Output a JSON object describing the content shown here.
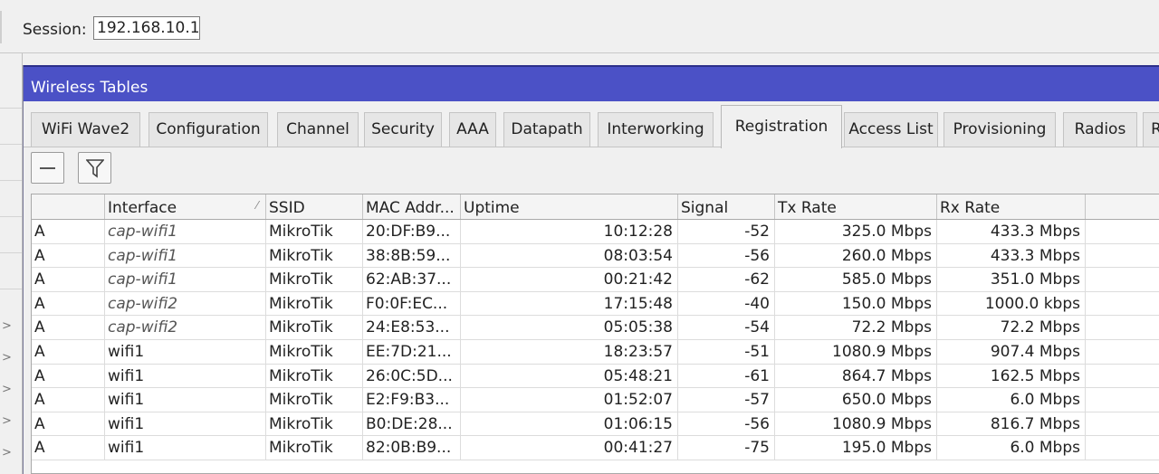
{
  "session": {
    "label": "Session:",
    "value": "192.168.10.1"
  },
  "window": {
    "title": "Wireless Tables"
  },
  "tabs": [
    {
      "label": "WiFi Wave2",
      "active": false
    },
    {
      "label": "Configuration",
      "active": false
    },
    {
      "label": "Channel",
      "active": false
    },
    {
      "label": "Security",
      "active": false
    },
    {
      "label": "AAA",
      "active": false
    },
    {
      "label": "Datapath",
      "active": false
    },
    {
      "label": "Interworking",
      "active": false
    },
    {
      "label": "Registration",
      "active": true
    },
    {
      "label": "Access List",
      "active": false
    },
    {
      "label": "Provisioning",
      "active": false
    },
    {
      "label": "Radios",
      "active": false
    },
    {
      "label": "R",
      "active": false
    }
  ],
  "toolbar": {
    "remove_icon": "minus-icon",
    "filter_icon": "filter-icon"
  },
  "table": {
    "columns": [
      "",
      "Interface",
      "SSID",
      "MAC Addr...",
      "Uptime",
      "Signal",
      "Tx Rate",
      "Rx Rate",
      ""
    ],
    "sort_column": "Interface",
    "rows": [
      {
        "flag": "A",
        "interface": "cap-wifi1",
        "italic": true,
        "ssid": "MikroTik",
        "mac": "20:DF:B9...",
        "uptime": "10:12:28",
        "signal": "-52",
        "tx": "325.0 Mbps",
        "rx": "433.3 Mbps"
      },
      {
        "flag": "A",
        "interface": "cap-wifi1",
        "italic": true,
        "ssid": "MikroTik",
        "mac": "38:8B:59...",
        "uptime": "08:03:54",
        "signal": "-56",
        "tx": "260.0 Mbps",
        "rx": "433.3 Mbps"
      },
      {
        "flag": "A",
        "interface": "cap-wifi1",
        "italic": true,
        "ssid": "MikroTik",
        "mac": "62:AB:37...",
        "uptime": "00:21:42",
        "signal": "-62",
        "tx": "585.0 Mbps",
        "rx": "351.0 Mbps"
      },
      {
        "flag": "A",
        "interface": "cap-wifi2",
        "italic": true,
        "ssid": "MikroTik",
        "mac": "F0:0F:EC...",
        "uptime": "17:15:48",
        "signal": "-40",
        "tx": "150.0 Mbps",
        "rx": "1000.0 kbps"
      },
      {
        "flag": "A",
        "interface": "cap-wifi2",
        "italic": true,
        "ssid": "MikroTik",
        "mac": "24:E8:53...",
        "uptime": "05:05:38",
        "signal": "-54",
        "tx": "72.2 Mbps",
        "rx": "72.2 Mbps"
      },
      {
        "flag": "A",
        "interface": "wifi1",
        "italic": false,
        "ssid": "MikroTik",
        "mac": "EE:7D:21...",
        "uptime": "18:23:57",
        "signal": "-51",
        "tx": "1080.9 Mbps",
        "rx": "907.4 Mbps"
      },
      {
        "flag": "A",
        "interface": "wifi1",
        "italic": false,
        "ssid": "MikroTik",
        "mac": "26:0C:5D...",
        "uptime": "05:48:21",
        "signal": "-61",
        "tx": "864.7 Mbps",
        "rx": "162.5 Mbps"
      },
      {
        "flag": "A",
        "interface": "wifi1",
        "italic": false,
        "ssid": "MikroTik",
        "mac": "E2:F9:B3...",
        "uptime": "01:52:07",
        "signal": "-57",
        "tx": "650.0 Mbps",
        "rx": "6.0 Mbps"
      },
      {
        "flag": "A",
        "interface": "wifi1",
        "italic": false,
        "ssid": "MikroTik",
        "mac": "B0:DE:28...",
        "uptime": "01:06:15",
        "signal": "-56",
        "tx": "1080.9 Mbps",
        "rx": "816.7 Mbps"
      },
      {
        "flag": "A",
        "interface": "wifi1",
        "italic": false,
        "ssid": "MikroTik",
        "mac": "82:0B:B9...",
        "uptime": "00:41:27",
        "signal": "-75",
        "tx": "195.0 Mbps",
        "rx": "6.0 Mbps"
      }
    ]
  },
  "colors": {
    "titlebar": "#4b51c6",
    "background": "#f0f0f0"
  }
}
